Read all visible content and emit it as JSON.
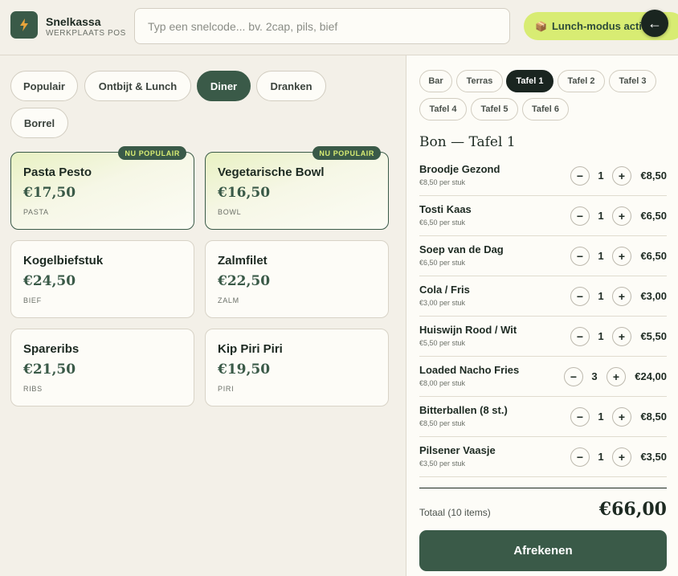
{
  "header": {
    "brand_title": "Snelkassa",
    "brand_subtitle": "WERKPLAATS POS",
    "search_placeholder": "Typ een snelcode... bv. 2cap, pils, bief",
    "lunch_mode_emoji": "📦",
    "lunch_mode_label": "Lunch-modus actief",
    "back_icon": "←"
  },
  "categories": [
    {
      "label": "Populair",
      "active": false
    },
    {
      "label": "Ontbijt & Lunch",
      "active": false
    },
    {
      "label": "Diner",
      "active": true
    },
    {
      "label": "Dranken",
      "active": false
    },
    {
      "label": "Borrel",
      "active": false
    }
  ],
  "products": [
    {
      "name": "Pasta Pesto",
      "price": "€17,50",
      "tag": "PASTA",
      "badge": "NU POPULAIR"
    },
    {
      "name": "Vegetarische Bowl",
      "price": "€16,50",
      "tag": "BOWL",
      "badge": "NU POPULAIR"
    },
    {
      "name": "Kogelbiefstuk",
      "price": "€24,50",
      "tag": "BIEF",
      "badge": ""
    },
    {
      "name": "Zalmfilet",
      "price": "€22,50",
      "tag": "ZALM",
      "badge": ""
    },
    {
      "name": "Spareribs",
      "price": "€21,50",
      "tag": "RIBS",
      "badge": ""
    },
    {
      "name": "Kip Piri Piri",
      "price": "€19,50",
      "tag": "PIRI",
      "badge": ""
    }
  ],
  "tables": [
    {
      "label": "Bar",
      "active": false
    },
    {
      "label": "Terras",
      "active": false
    },
    {
      "label": "Tafel 1",
      "active": true
    },
    {
      "label": "Tafel 2",
      "active": false
    },
    {
      "label": "Tafel 3",
      "active": false
    },
    {
      "label": "Tafel 4",
      "active": false
    },
    {
      "label": "Tafel 5",
      "active": false
    },
    {
      "label": "Tafel 6",
      "active": false
    }
  ],
  "bon": {
    "title": "Bon — Tafel 1",
    "minus": "−",
    "plus": "+",
    "lines": [
      {
        "name": "Broodje Gezond",
        "unit": "€8,50 per stuk",
        "qty": "1",
        "total": "€8,50"
      },
      {
        "name": "Tosti Kaas",
        "unit": "€6,50 per stuk",
        "qty": "1",
        "total": "€6,50"
      },
      {
        "name": "Soep van de Dag",
        "unit": "€6,50 per stuk",
        "qty": "1",
        "total": "€6,50"
      },
      {
        "name": "Cola / Fris",
        "unit": "€3,00 per stuk",
        "qty": "1",
        "total": "€3,00"
      },
      {
        "name": "Huiswijn Rood / Wit",
        "unit": "€5,50 per stuk",
        "qty": "1",
        "total": "€5,50"
      },
      {
        "name": "Loaded Nacho Fries",
        "unit": "€8,00 per stuk",
        "qty": "3",
        "total": "€24,00"
      },
      {
        "name": "Bitterballen (8 st.)",
        "unit": "€8,50 per stuk",
        "qty": "1",
        "total": "€8,50"
      },
      {
        "name": "Pilsener Vaasje",
        "unit": "€3,50 per stuk",
        "qty": "1",
        "total": "€3,50"
      }
    ],
    "total_label": "Totaal (10 items)",
    "total_value": "€66,00",
    "checkout_label": "Afrekenen"
  },
  "colors": {
    "accent": "#3a5a48",
    "lime": "#d8ec73",
    "dark": "#1a2520"
  }
}
